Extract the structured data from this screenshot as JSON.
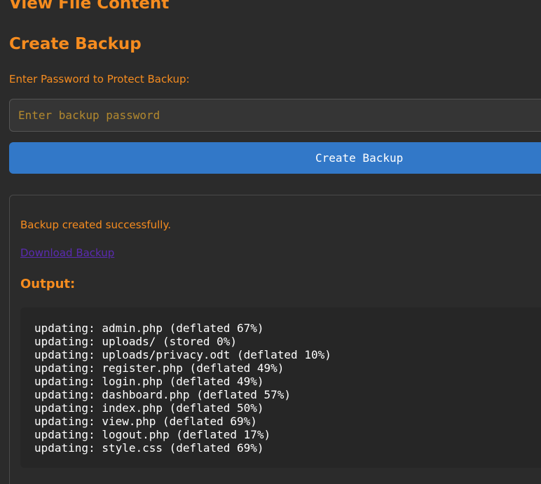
{
  "page": {
    "top_heading": "View File Content",
    "section_title": "Create Backup"
  },
  "backup_form": {
    "password_label": "Enter Password to Protect Backup:",
    "password_placeholder": "Enter backup password",
    "password_value": "",
    "submit_label": "Create Backup"
  },
  "result": {
    "message": "Backup created successfully.",
    "download_link": "Download Backup",
    "output_title": "Output:",
    "output_lines": [
      "updating: admin.php (deflated 67%)",
      "updating: uploads/ (stored 0%)",
      "updating: uploads/privacy.odt (deflated 10%)",
      "updating: register.php (deflated 49%)",
      "updating: login.php (deflated 49%)",
      "updating: dashboard.php (deflated 57%)",
      "updating: index.php (deflated 50%)",
      "updating: view.php (deflated 69%)",
      "updating: logout.php (deflated 17%)",
      "updating: style.css (deflated 69%)"
    ]
  },
  "colors": {
    "accent": "#f68c1f",
    "button": "#3278c8",
    "background": "#2b2b2b",
    "link": "#5a2bb0"
  }
}
